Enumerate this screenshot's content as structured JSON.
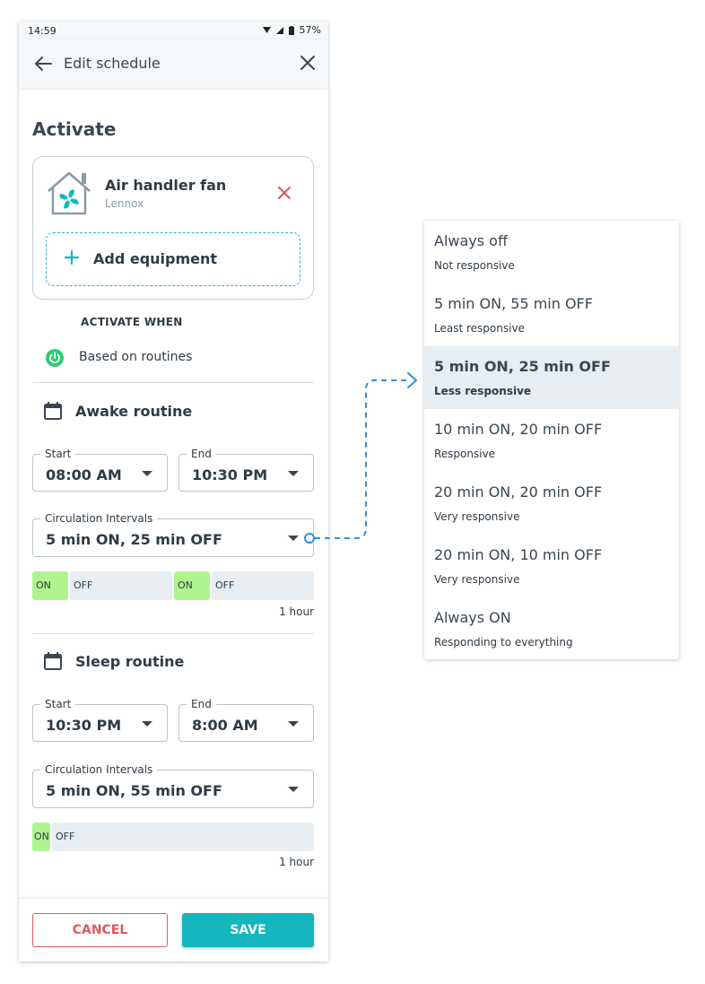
{
  "status_bar": {
    "time": "14:59",
    "battery": "57%"
  },
  "app_bar": {
    "title": "Edit schedule"
  },
  "activate": {
    "title": "Activate",
    "equipment": {
      "name": "Air handler fan",
      "brand": "Lennox"
    },
    "add_equipment_label": "Add equipment",
    "activate_when_label": "ACTIVATE WHEN",
    "mode": "Based on routines"
  },
  "routines": [
    {
      "title": "Awake routine",
      "start_label": "Start",
      "start_value": "08:00 AM",
      "end_label": "End",
      "end_value": "10:30 PM",
      "interval_label": "Circulation Intervals",
      "interval_value": "5 min ON, 25 min OFF",
      "on_label": "ON",
      "off_label": "OFF",
      "scale_label": "1 hour"
    },
    {
      "title": "Sleep routine",
      "start_label": "Start",
      "start_value": "10:30 PM",
      "end_label": "End",
      "end_value": "8:00 AM",
      "interval_label": "Circulation Intervals",
      "interval_value": "5 min ON, 55 min OFF",
      "on_label": "ON",
      "off_label": "OFF",
      "scale_label": "1 hour"
    }
  ],
  "footer": {
    "cancel_label": "CANCEL",
    "save_label": "SAVE"
  },
  "interval_menu": {
    "selected_index": 2,
    "options": [
      {
        "title": "Always off",
        "subtitle": "Not responsive"
      },
      {
        "title": "5 min ON, 55 min OFF",
        "subtitle": "Least responsive"
      },
      {
        "title": "5 min ON, 25 min OFF",
        "subtitle": "Less responsive"
      },
      {
        "title": "10 min ON, 20 min OFF",
        "subtitle": "Responsive"
      },
      {
        "title": "20 min ON, 20 min OFF",
        "subtitle": "Very responsive"
      },
      {
        "title": "20 min ON, 10 min OFF",
        "subtitle": "Very responsive"
      },
      {
        "title": "Always ON",
        "subtitle": "Responding to everything"
      }
    ]
  },
  "colors": {
    "accent": "#14b7bd",
    "danger": "#e0585b",
    "on_segment": "#aef58f",
    "off_segment": "#e7edf0",
    "connector": "#2f8fe0",
    "power_icon": "#2ecc71"
  },
  "icons": [
    "back-arrow-icon",
    "close-icon",
    "fan-house-icon",
    "remove-icon",
    "plus-icon",
    "power-icon",
    "calendar-icon",
    "chevron-down-icon",
    "wifi-icon",
    "signal-icon",
    "battery-icon"
  ]
}
